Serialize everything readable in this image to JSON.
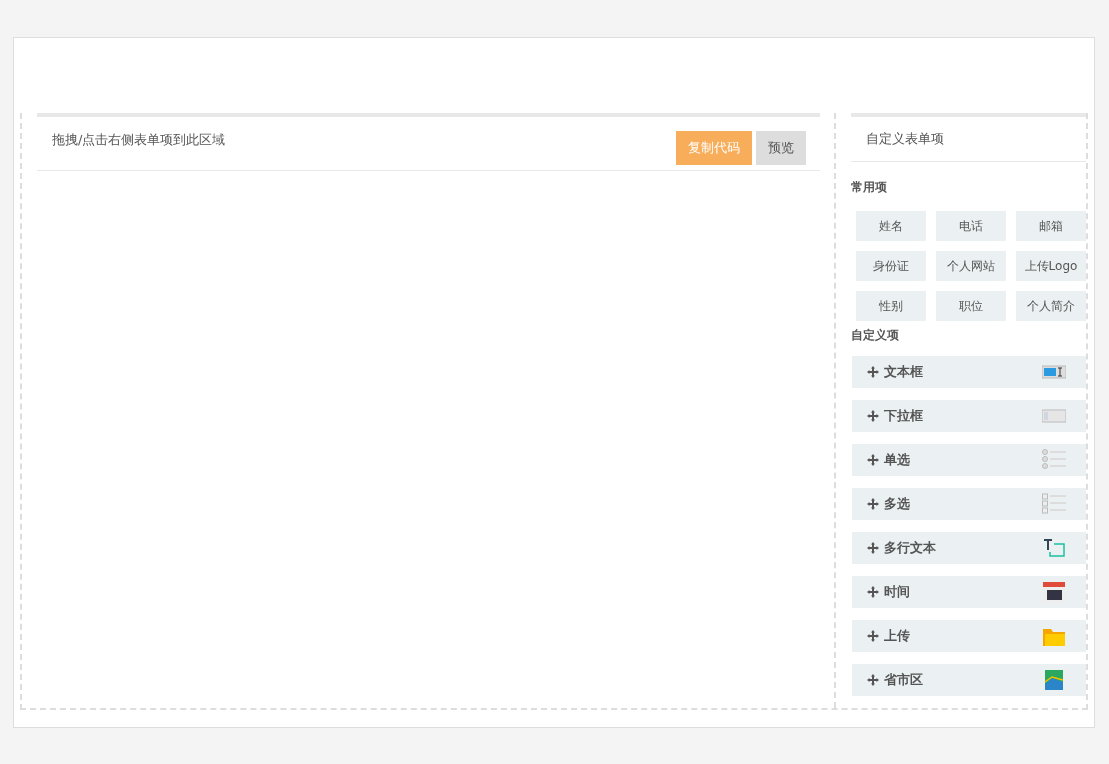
{
  "canvas": {
    "hint": "拖拽/点击右侧表单项到此区域",
    "buttons": [
      {
        "label": "复制代码",
        "kind": "primary"
      },
      {
        "label": "预览",
        "kind": "default"
      }
    ]
  },
  "palette": {
    "title": "自定义表单项",
    "common_heading": "常用项",
    "common_items": [
      "姓名",
      "电话",
      "邮箱",
      "身份证",
      "个人网站",
      "上传Logo",
      "性别",
      "职位",
      "个人简介"
    ],
    "custom_heading": "自定义项",
    "custom_items": [
      {
        "label": "文本框",
        "kind": "text"
      },
      {
        "label": "下拉框",
        "kind": "select"
      },
      {
        "label": "单选",
        "kind": "radio"
      },
      {
        "label": "多选",
        "kind": "checkbox"
      },
      {
        "label": "多行文本",
        "kind": "textarea"
      },
      {
        "label": "时间",
        "kind": "date"
      },
      {
        "label": "上传",
        "kind": "upload"
      },
      {
        "label": "省市区",
        "kind": "region"
      }
    ]
  }
}
